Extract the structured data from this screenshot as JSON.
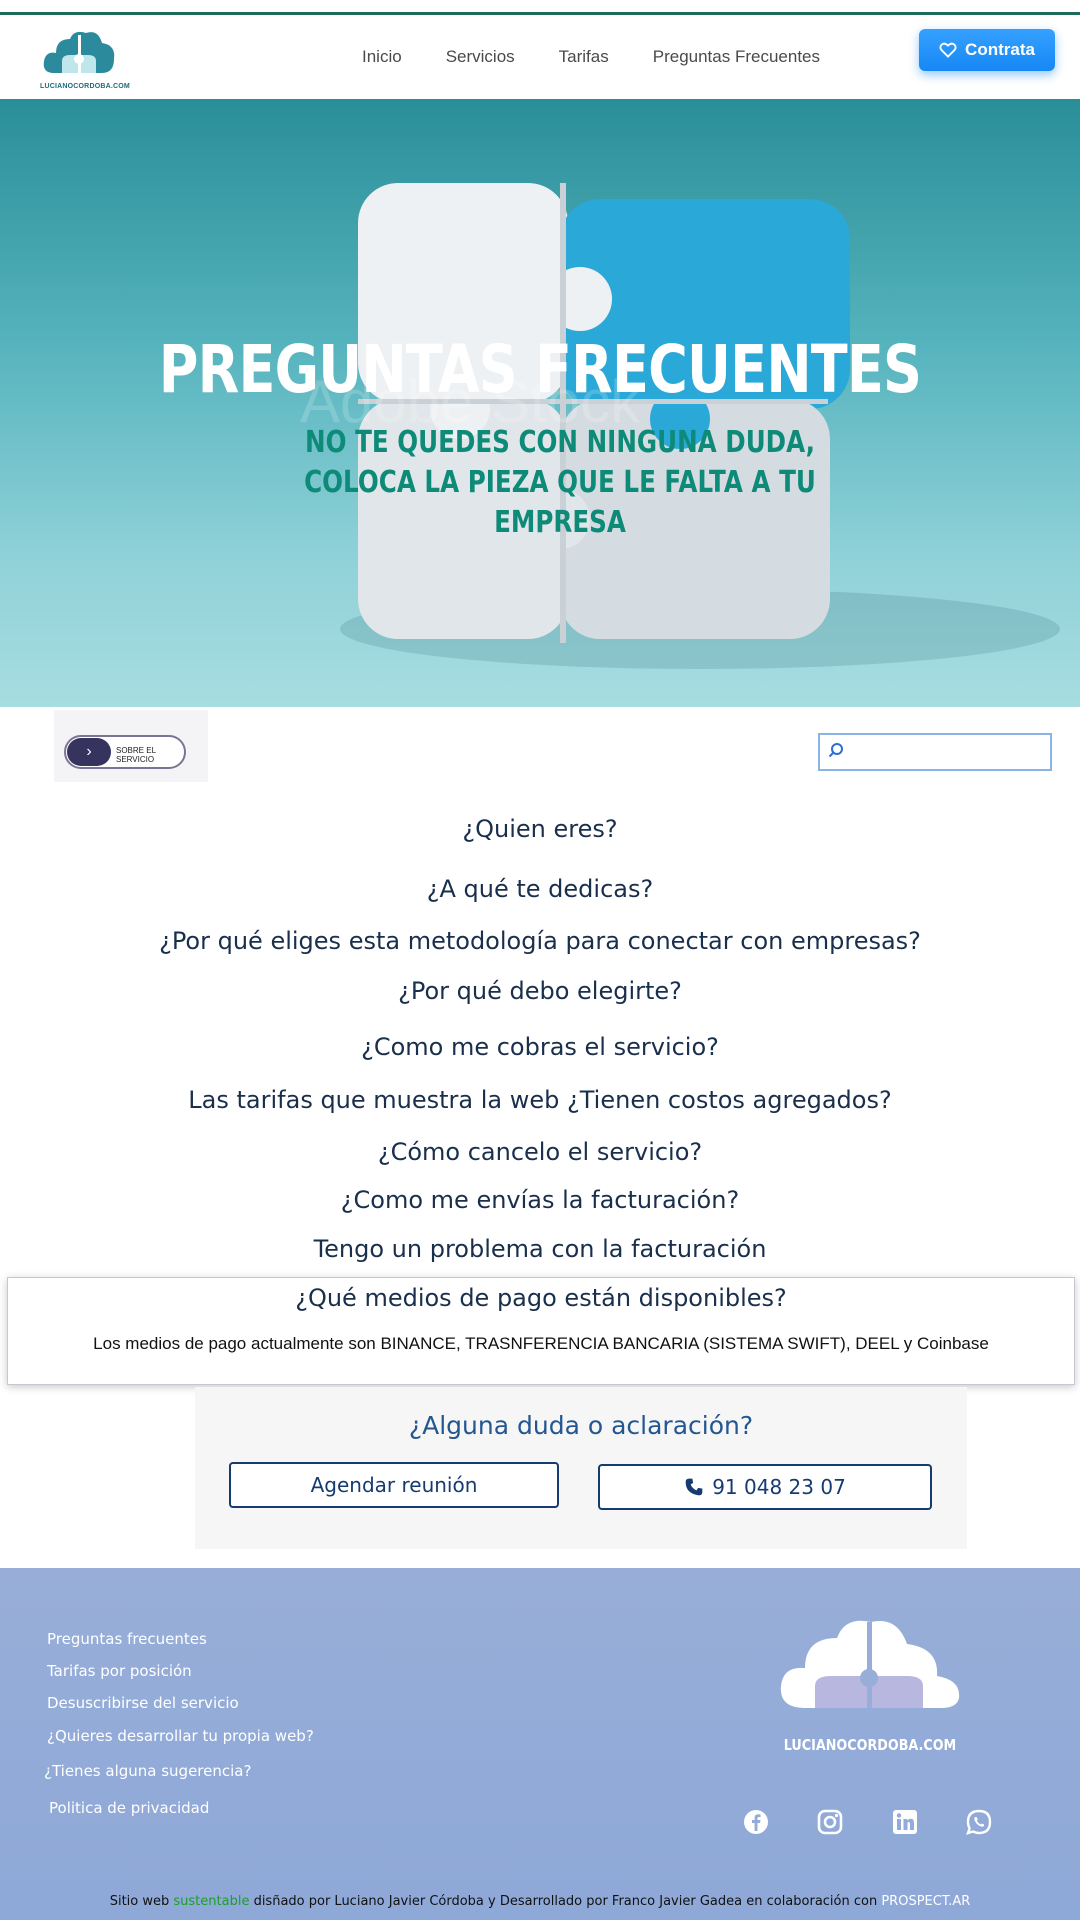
{
  "header": {
    "logo_text": "LUCIANOCORDOBA.COM",
    "nav": [
      "Inicio",
      "Servicios",
      "Tarifas",
      "Preguntas Frecuentes"
    ],
    "cta_label": "Contrata"
  },
  "hero": {
    "title": "PREGUNTAS FRECUENTES",
    "subtitle": "NO TE QUEDES CON NINGUNA DUDA, COLOCA LA PIEZA QUE LE FALTA A TU EMPRESA",
    "watermark": "Adobe Stock"
  },
  "toolbar": {
    "toggle_label": "SOBRE EL SERVICIO",
    "search_value": ""
  },
  "faq": {
    "questions": [
      "¿Quien eres?",
      "¿A qué te dedicas?",
      "¿Por qué eliges esta metodología para conectar con empresas?",
      "¿Por qué debo elegirte?",
      "¿Como me cobras el servicio?",
      "Las tarifas que muestra la web ¿Tienen costos agregados?",
      "¿Cómo cancelo el servicio?",
      "¿Como me envías la facturación?",
      "Tengo un problema con la facturación"
    ],
    "open_question": "¿Qué medios de pago están disponibles?",
    "open_answer": "Los medios de pago actualmente son BINANCE, TRASNFERENCIA BANCARIA (SISTEMA SWIFT), DEEL y Coinbase"
  },
  "contact": {
    "title": "¿Alguna duda o aclaración?",
    "meeting_label": "Agendar reunión",
    "phone_label": "91 048 23 07"
  },
  "footer": {
    "links": [
      "Preguntas frecuentes",
      "Tarifas por posición",
      "Desuscribirse del servicio",
      "¿Quieres desarrollar tu propia web?",
      "¿Tienes alguna sugerencia?",
      "Politica de privacidad"
    ],
    "logo_text": "LUCIANOCORDOBA.COM",
    "social": [
      "facebook-icon",
      "instagram-icon",
      "linkedin-icon",
      "whatsapp-icon"
    ],
    "credit_start": "Sitio web ",
    "credit_green": "sustentable",
    "credit_middle": " disñado por Luciano Javier Córdoba y Desarrollado por Franco Javier Gadea en colaboración con ",
    "credit_end": "PROSPECT.AR"
  },
  "colors": {
    "accent": "#1688f5",
    "heading": "#1a2f4c",
    "footer_bg": "#93abd8",
    "hero_subtitle": "#0e8a78"
  }
}
